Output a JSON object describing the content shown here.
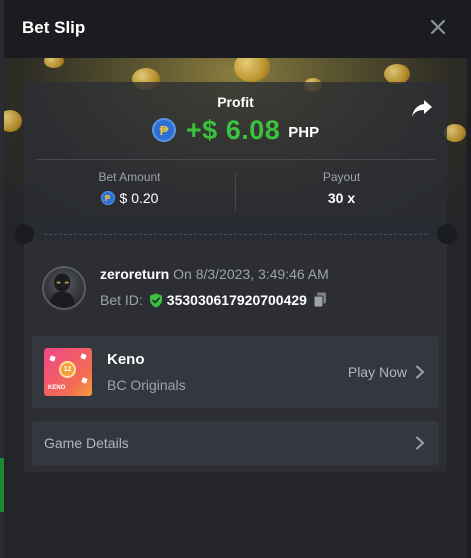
{
  "modal": {
    "title": "Bet Slip"
  },
  "summary": {
    "profit_label": "Profit",
    "profit_value": "+$ 6.08",
    "profit_currency": "PHP",
    "currency_symbol": "₱",
    "bet_amount_label": "Bet Amount",
    "bet_amount_value": "$ 0.20",
    "payout_label": "Payout",
    "payout_value": "30 x"
  },
  "user": {
    "name": "zeroreturn",
    "date_text": " On 8/3/2023, 3:49:46 AM",
    "bet_id_label": "Bet ID:",
    "bet_id": "353030617920700429"
  },
  "game": {
    "thumb_number": "12",
    "thumb_label": "KENO",
    "name": "Keno",
    "provider": "BC Originals",
    "play_label": "Play Now"
  },
  "details": {
    "label": "Game Details"
  },
  "icons": {
    "close": "close-icon",
    "share": "share-icon",
    "shield": "shield-check-icon",
    "copy": "copy-icon",
    "chevron": "chevron-right-icon"
  },
  "colors": {
    "profit_green": "#3cc13f",
    "modal_bg": "#232529",
    "card_bg": "#2c2e34",
    "coin_blue": "#2f6fd1"
  }
}
